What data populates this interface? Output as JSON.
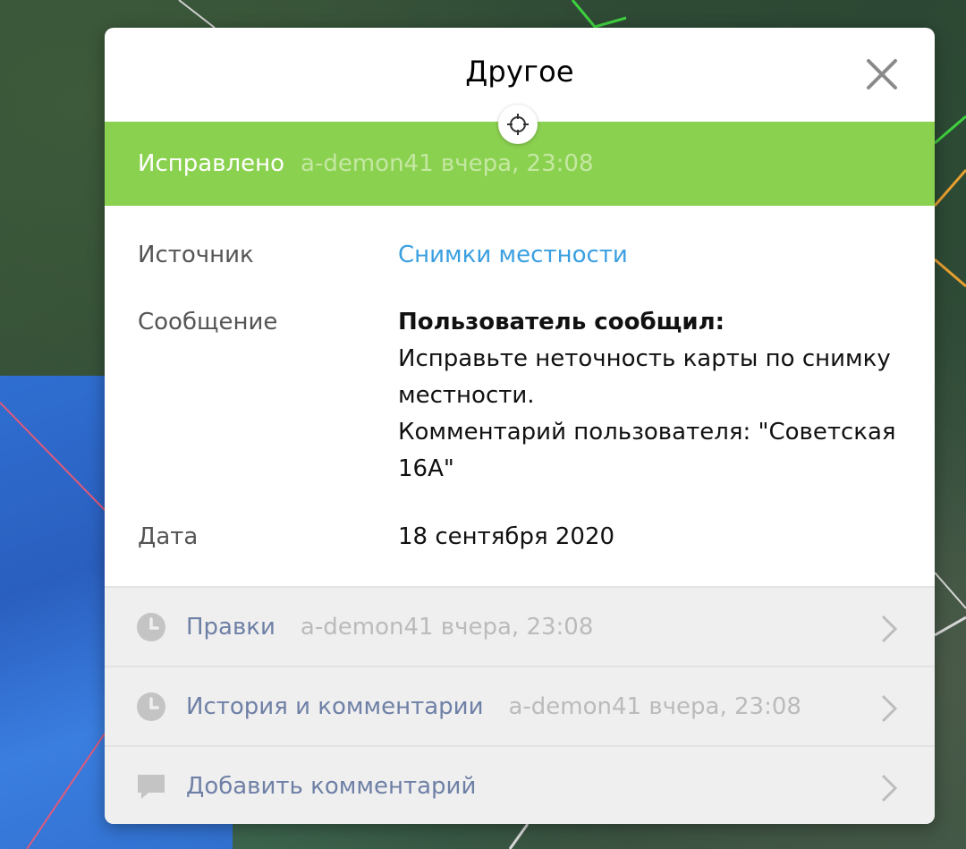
{
  "card": {
    "title": "Другое"
  },
  "status": {
    "label": "Исправлено",
    "meta": "a-demon41 вчера, 23:08",
    "color": "#8bd150"
  },
  "details": {
    "source_label": "Источник",
    "source_value": "Снимки местности",
    "message_label": "Сообщение",
    "message_heading": "Пользователь сообщил:",
    "message_line1": "Исправьте неточность карты по снимку",
    "message_line2": "местности.",
    "message_line3": "Комментарий пользователя: \"Советская",
    "message_line4": "16А\"",
    "date_label": "Дата",
    "date_value": "18 сентября 2020"
  },
  "actions": [
    {
      "icon": "clock-icon",
      "label": "Правки",
      "meta": "a-demon41 вчера, 23:08"
    },
    {
      "icon": "clock-icon",
      "label": "История и комментарии",
      "meta": "a-demon41 вчера, 23:08"
    },
    {
      "icon": "comment-icon",
      "label": "Добавить комментарий",
      "meta": ""
    }
  ],
  "colors": {
    "accent_link": "#3a9fe0",
    "action_label": "#6f80a6",
    "status_green": "#8bd150"
  }
}
